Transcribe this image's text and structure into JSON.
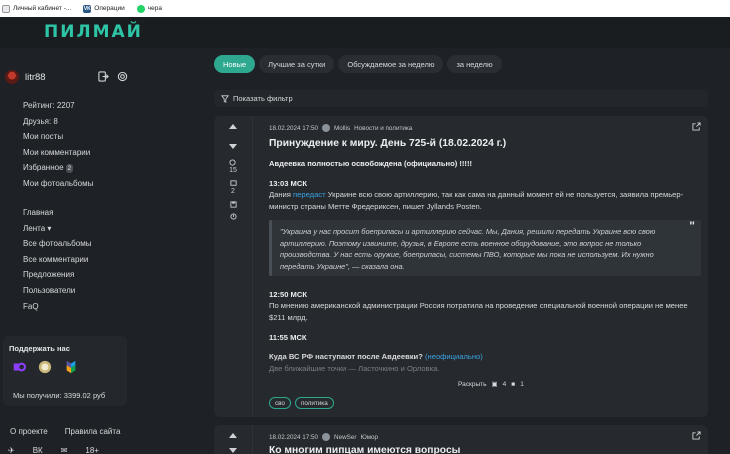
{
  "bookmarks": [
    {
      "label": "Личный кабинет -...",
      "icon": "document-icon"
    },
    {
      "label": "Операции",
      "icon": "vk-icon"
    },
    {
      "label": "чера",
      "icon": "whatsapp-icon"
    }
  ],
  "header": {
    "logo": "ПИЛМАЙ"
  },
  "sidebar": {
    "username": "litr88",
    "stats": [
      "Рейтинг: 2207",
      "Друзья: 8",
      "Мои посты",
      "Мои комментарии"
    ],
    "favorites_label": "Избранное",
    "favorites_count": "2",
    "albums": "Мои фотоальбомы",
    "nav": [
      "Главная",
      "Лента ▾",
      "Все фотоальбомы",
      "Все комментарии",
      "Предложения",
      "Пользователи",
      "FaQ"
    ],
    "support": {
      "title": "Поддержать нас",
      "received": "Мы получили: 3399.02 руб"
    },
    "bottom_links": [
      "О проекте",
      "Правила сайта"
    ],
    "social": [
      "✈",
      "ВК",
      "✉",
      "18+"
    ]
  },
  "tabs": [
    "Новые",
    "Лучшие за сутки",
    "Обсуждаемое за неделю",
    "за неделю"
  ],
  "filter": {
    "label": "Показать фильтр"
  },
  "posts": [
    {
      "meta_date": "18.02.2024 17:50",
      "meta_author": "Mollis",
      "meta_category": "Новости и политика",
      "title": "Принуждение к миру. День 725-й (18.02.2024 г.)",
      "headline": "Авдеевка полностью освобождена (официально) !!!!!",
      "time1": "13:03 МСК",
      "text1_a": "Дания ",
      "text1_link": "передаст",
      "text1_b": " Украине всю свою артиллерию, так как сама на данный момент ей не пользуется, заявила премьер-министр страны Метте Фредериксен, пишет Jyllands Posten.",
      "quote": "\"Украина у нас просит боеприпасы и артиллерию сейчас. Мы, Дания, решили передать Украине всю свою артиллерию. Поэтому извините, друзья, в Европе есть военное оборудование, это вопрос не только производства. У нас есть оружие, боеприпасы, системы ПВО, которые мы пока не используем. Их нужно передать Украине\", — сказала она.",
      "time2": "12:50 МСК",
      "text2": "По мнению американской администрации Россия потратила на проведение специальной военной операции не менее $211 млрд.",
      "time3": "11:55 МСК",
      "headline2": "Куда ВС РФ наступают после Авдеевки?",
      "headline2_link": "(неофициально)",
      "faded_line": "Две ближайшие точки — Ласточкино и Орловка.",
      "expand": "Раскрыть",
      "image_count": "4",
      "video_count": "1",
      "comments": "15",
      "saves": "2",
      "tags": [
        "сво",
        "политика"
      ]
    },
    {
      "meta_date": "18.02.2024 17:50",
      "meta_author": "NewSer",
      "meta_category": "Юмор",
      "title": "Ко многим пипцам имеются вопросы"
    }
  ]
}
